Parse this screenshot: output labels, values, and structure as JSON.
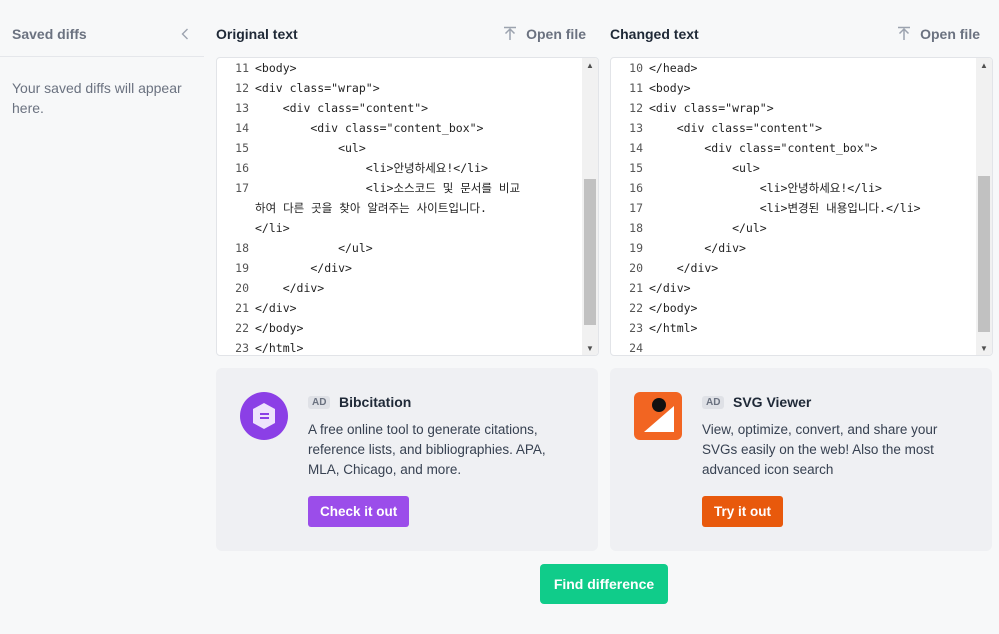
{
  "sidebar": {
    "title": "Saved diffs",
    "empty_message": "Your saved diffs will appear here."
  },
  "original": {
    "title": "Original text",
    "open_label": "Open file",
    "lines": [
      {
        "n": "11",
        "text": "<body>"
      },
      {
        "n": "12",
        "text": "<div class=\"wrap\">"
      },
      {
        "n": "13",
        "text": "    <div class=\"content\">"
      },
      {
        "n": "14",
        "text": "        <div class=\"content_box\">"
      },
      {
        "n": "15",
        "text": "            <ul>"
      },
      {
        "n": "16",
        "text": "                <li>안녕하세요!</li>"
      },
      {
        "n": "17",
        "text": "                <li>소스코드 및 문서를 비교"
      },
      {
        "n": "",
        "text": "하여 다른 곳을 찾아 알려주는 사이트입니다."
      },
      {
        "n": "",
        "text": "</li>"
      },
      {
        "n": "18",
        "text": "            </ul>"
      },
      {
        "n": "19",
        "text": "        </div>"
      },
      {
        "n": "20",
        "text": "    </div>"
      },
      {
        "n": "21",
        "text": "</div>"
      },
      {
        "n": "22",
        "text": "</body>"
      },
      {
        "n": "23",
        "text": "</html>"
      }
    ]
  },
  "changed": {
    "title": "Changed text",
    "open_label": "Open file",
    "lines": [
      {
        "n": "10",
        "text": "</head>"
      },
      {
        "n": "11",
        "text": "<body>"
      },
      {
        "n": "12",
        "text": "<div class=\"wrap\">"
      },
      {
        "n": "13",
        "text": "    <div class=\"content\">"
      },
      {
        "n": "14",
        "text": "        <div class=\"content_box\">"
      },
      {
        "n": "15",
        "text": "            <ul>"
      },
      {
        "n": "16",
        "text": "                <li>안녕하세요!</li>"
      },
      {
        "n": "17",
        "text": "                <li>변경된 내용입니다.</li>"
      },
      {
        "n": "18",
        "text": "            </ul>"
      },
      {
        "n": "19",
        "text": "        </div>"
      },
      {
        "n": "20",
        "text": "    </div>"
      },
      {
        "n": "21",
        "text": "</div>"
      },
      {
        "n": "22",
        "text": "</body>"
      },
      {
        "n": "23",
        "text": "</html>"
      },
      {
        "n": "24",
        "text": ""
      }
    ]
  },
  "ads": [
    {
      "tag": "AD",
      "name": "Bibcitation",
      "description": "A free online tool to generate citations, reference lists, and bibliographies. APA, MLA, Chicago, and more.",
      "button": "Check it out",
      "button_color": "#9b4dea",
      "logo_color": "#8b3fe6",
      "logo_icon": "citation-icon"
    },
    {
      "tag": "AD",
      "name": "SVG Viewer",
      "description": "View, optimize, convert, and share your SVGs easily on the web! Also the most advanced icon search",
      "button": "Try it out",
      "button_color": "#e8590c",
      "logo_color": "#f26522",
      "logo_icon": "svg-viewer-icon"
    }
  ],
  "find_button": "Find difference",
  "colors": {
    "accent_green": "#10cc8a",
    "background": "#f7f8f9"
  }
}
